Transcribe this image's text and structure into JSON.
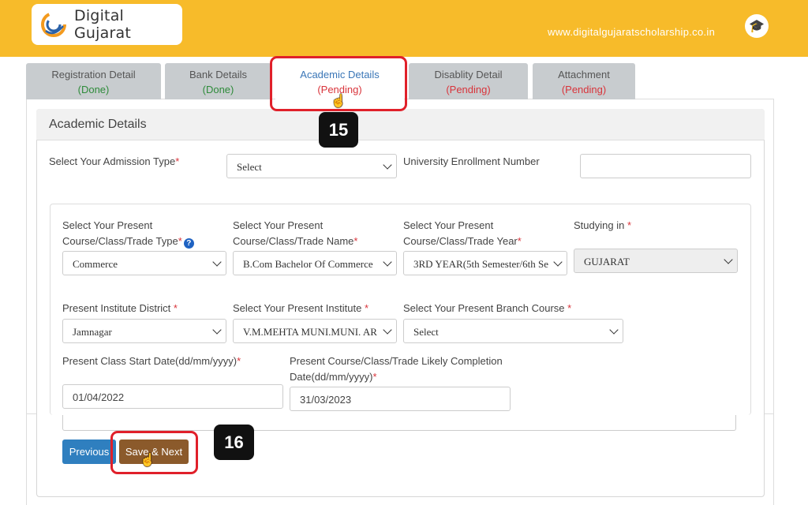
{
  "header": {
    "logo_text": "Digital Gujarat",
    "url": "www.digitalgujaratscholarship.co.in"
  },
  "tabs": [
    {
      "label": "Registration Detail",
      "status": "(Done)"
    },
    {
      "label": "Bank Details",
      "status": "(Done)"
    },
    {
      "label": "Academic Details",
      "status": "(Pending)"
    },
    {
      "label": "Disablity Detail",
      "status": "(Pending)"
    },
    {
      "label": "Attachment",
      "status": "(Pending)"
    }
  ],
  "steps": {
    "tab_step": "15",
    "save_step": "16"
  },
  "section_title": "Academic Details",
  "form": {
    "admission_type": {
      "label": "Select Your Admission Type",
      "value": "Select"
    },
    "enrollment": {
      "label": "University Enrollment Number",
      "value": ""
    },
    "course_type": {
      "label_line1": "Select Your Present",
      "label_line2": "Course/Class/Trade Type",
      "value": "Commerce",
      "help": "?"
    },
    "course_name": {
      "label_line1": "Select Your Present",
      "label_line2": "Course/Class/Trade Name",
      "value": "B.Com Bachelor Of Commerce"
    },
    "course_year": {
      "label_line1": "Select Your Present",
      "label_line2": "Course/Class/Trade Year",
      "value": "3RD YEAR(5th Semester/6th Se"
    },
    "studying_in": {
      "label": "Studying in ",
      "value": "GUJARAT"
    },
    "district": {
      "label": "Present Institute District ",
      "value": "Jamnagar"
    },
    "institute": {
      "label": "Select Your Present Institute ",
      "value": "V.M.MEHTA MUNI.MUNI. AR"
    },
    "branch": {
      "label": "Select Your Present Branch Course ",
      "value": "Select"
    },
    "start_date": {
      "label": "Present Class Start Date(dd/mm/yyyy)",
      "value": "01/04/2022"
    },
    "completion_date": {
      "label_line1": "Present Course/Class/Trade Likely Completion",
      "label_line2": "Date(dd/mm/yyyy)",
      "value": "31/03/2023"
    },
    "required_mark": "*"
  },
  "buttons": {
    "previous": "Previous",
    "save_next": "Save & Next"
  },
  "colors": {
    "topbar": "#f7bb2a",
    "highlight": "#e0202a",
    "save_button": "#8b5a2b",
    "prev_button": "#2f7fbf"
  }
}
